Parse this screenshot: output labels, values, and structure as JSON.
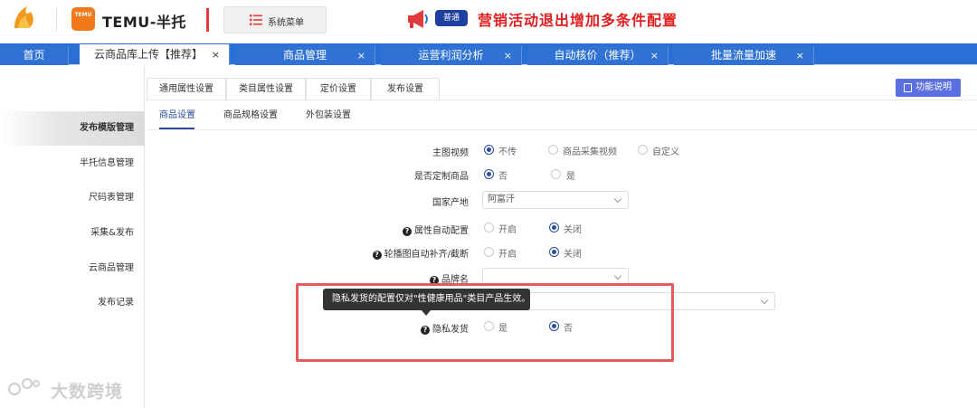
{
  "header": {
    "brand_title": "TEMU-半托",
    "temu_badge": "TEMU",
    "system_menu": "系统菜单",
    "notice_tag": "普通",
    "notice_text": "营销活动退出增加多条件配置"
  },
  "nav_tabs": [
    {
      "label": "首页"
    },
    {
      "label": "云商品库上传【推荐】",
      "close": "×"
    },
    {
      "label": "商品管理",
      "close": "×"
    },
    {
      "label": "运营利润分析",
      "close": "×"
    },
    {
      "label": "自动核价（推荐）",
      "close": "×"
    },
    {
      "label": "批量流量加速",
      "close": "×"
    }
  ],
  "sidebar": {
    "items": [
      {
        "label": "发布模版管理"
      },
      {
        "label": "半托信息管理"
      },
      {
        "label": "尺码表管理"
      },
      {
        "label": "采集&发布"
      },
      {
        "label": "云商品管理"
      },
      {
        "label": "发布记录"
      }
    ]
  },
  "main_tabs": [
    {
      "label": "通用属性设置"
    },
    {
      "label": "类目属性设置"
    },
    {
      "label": "定价设置"
    },
    {
      "label": "发布设置"
    }
  ],
  "help_button": "功能说明",
  "sub_tabs": [
    {
      "label": "商品设置"
    },
    {
      "label": "商品规格设置"
    },
    {
      "label": "外包装设置"
    }
  ],
  "form": {
    "main_video": {
      "label": "主图视频",
      "options": [
        "不传",
        "商品采集视频",
        "自定义"
      ]
    },
    "custom_product": {
      "label": "是否定制商品",
      "options": [
        "否",
        "是"
      ]
    },
    "origin": {
      "label": "国家产地",
      "value": "阿富汗"
    },
    "auto_attr": {
      "label": "属性自动配置",
      "options": [
        "开启",
        "关闭"
      ]
    },
    "carousel": {
      "label": "轮播图自动补齐/截断",
      "options": [
        "开启",
        "关闭"
      ]
    },
    "brand": {
      "label": "品牌名",
      "value": ""
    },
    "privacy": {
      "label": "隐私发货",
      "options": [
        "是",
        "否"
      ]
    }
  },
  "tooltip": "隐私发货的配置仅对\"性健康用品\"类目产品生效。",
  "watermark": "大数跨境",
  "colors": {
    "brand_blue": "#2a6fd6",
    "notice_red": "#e02020",
    "highlight_box": "#e45b5b",
    "accent": "#2a4d9e"
  }
}
